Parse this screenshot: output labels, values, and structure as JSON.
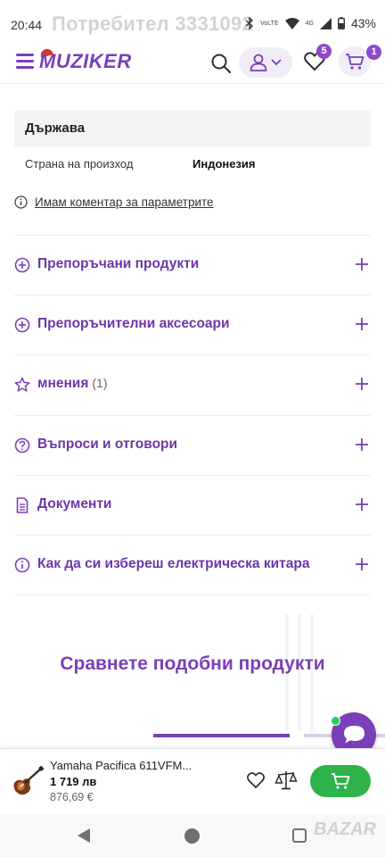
{
  "status_bar": {
    "time": "20:44",
    "watermark": "Потребител 3331092",
    "volte": "VoLTE",
    "network": "4G",
    "battery": "43%"
  },
  "header": {
    "logo": "MUZIKER",
    "wishlist_count": "5",
    "cart_count": "1"
  },
  "params": {
    "group_title": "Държава",
    "row_key": "Страна на произход",
    "row_value": "Индонезия",
    "comment_link": "Имам коментар за параметрите"
  },
  "accordion": [
    {
      "label": "Препоръчани продукти",
      "icon": "plus-circle-icon"
    },
    {
      "label": "Препоръчителни аксесоари",
      "icon": "plus-circle-icon"
    },
    {
      "label": "мнения",
      "count": "(1)",
      "icon": "star-icon"
    },
    {
      "label": "Въпроси и отговори",
      "icon": "question-circle-icon"
    },
    {
      "label": "Документи",
      "icon": "document-icon"
    },
    {
      "label": "Как да си избереш електрическа китара",
      "icon": "info-circle-icon"
    }
  ],
  "compare": {
    "title": "Сравнете подобни продукти"
  },
  "product_bar": {
    "name": "Yamaha Pacifica 611VFM...",
    "price": "1 719 лв",
    "old_price": "876,69 €"
  },
  "watermark_bottom": "BAZAR",
  "colors": {
    "brand": "#7b3fb8",
    "cart_button": "#2fb24a",
    "online_dot": "#23d160"
  }
}
